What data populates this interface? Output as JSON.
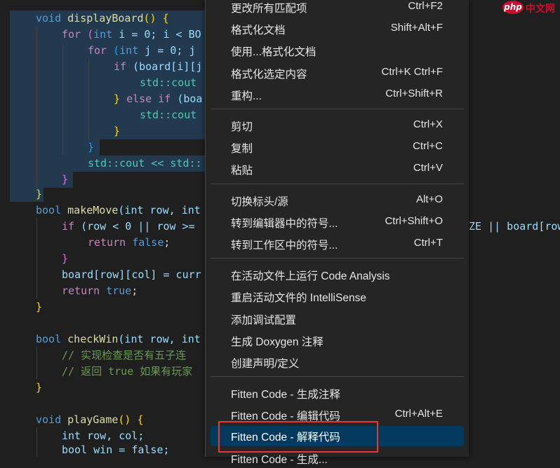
{
  "code": {
    "void_kw": "void",
    "bool_kw": "bool",
    "int_kw": "int",
    "for_kw": "for",
    "if_kw": "if",
    "else_kw": "else",
    "return_kw": "return",
    "true_kw": "true",
    "false_kw": "false",
    "displayBoard": "displayBoard",
    "makeMove": "makeMove",
    "checkWin": "checkWin",
    "playGame": "playGame",
    "line_for1_rest": "i = 0; i < BO",
    "line_for2_rest": "j = 0; j",
    "line_if_rest": "(board[i][j",
    "std_cout": "std::cout",
    "else_if_rest": "(boa",
    "std_cout_endl": "std::cout << std::",
    "params_makeMove": "(int row, int",
    "if_row_check": "(row < 0 || row >=",
    "board_assign": "board[row][col] = curr",
    "params_checkWin": "(int row, int",
    "comment1": "// 实现检查是否有五子连",
    "comment2": "// 返回 true 如果有玩家",
    "int_row_col": "int row, col;",
    "bool_win": "bool win = false;",
    "right_fragment": "ZE || board[row"
  },
  "context_menu": {
    "items": [
      {
        "label": "更改所有匹配项",
        "shortcut": "Ctrl+F2"
      },
      {
        "label": "格式化文档",
        "shortcut": "Shift+Alt+F"
      },
      {
        "label": "使用...格式化文档",
        "shortcut": ""
      },
      {
        "label": "格式化选定内容",
        "shortcut": "Ctrl+K Ctrl+F"
      },
      {
        "label": "重构...",
        "shortcut": "Ctrl+Shift+R"
      },
      {
        "label": "剪切",
        "shortcut": "Ctrl+X"
      },
      {
        "label": "复制",
        "shortcut": "Ctrl+C"
      },
      {
        "label": "粘贴",
        "shortcut": "Ctrl+V"
      },
      {
        "label": "切换标头/源",
        "shortcut": "Alt+O"
      },
      {
        "label": "转到编辑器中的符号...",
        "shortcut": "Ctrl+Shift+O"
      },
      {
        "label": "转到工作区中的符号...",
        "shortcut": "Ctrl+T"
      },
      {
        "label": "在活动文件上运行 Code Analysis",
        "shortcut": ""
      },
      {
        "label": "重启活动文件的 IntelliSense",
        "shortcut": ""
      },
      {
        "label": "添加调试配置",
        "shortcut": ""
      },
      {
        "label": "生成 Doxygen 注释",
        "shortcut": ""
      },
      {
        "label": "创建声明/定义",
        "shortcut": ""
      },
      {
        "label": "Fitten Code - 生成注释",
        "shortcut": ""
      },
      {
        "label": "Fitten Code - 编辑代码",
        "shortcut": "Ctrl+Alt+E"
      },
      {
        "label": "Fitten Code - 解释代码",
        "shortcut": ""
      },
      {
        "label": "Fitten Code - 生成...",
        "shortcut": ""
      }
    ]
  },
  "watermark": {
    "brand": "php",
    "text": "中文网"
  },
  "colors": {
    "accent_highlight": "#04395e",
    "annotation_box": "#e53935",
    "menu_bg": "#252526",
    "editor_bg": "#1f1f1f"
  }
}
